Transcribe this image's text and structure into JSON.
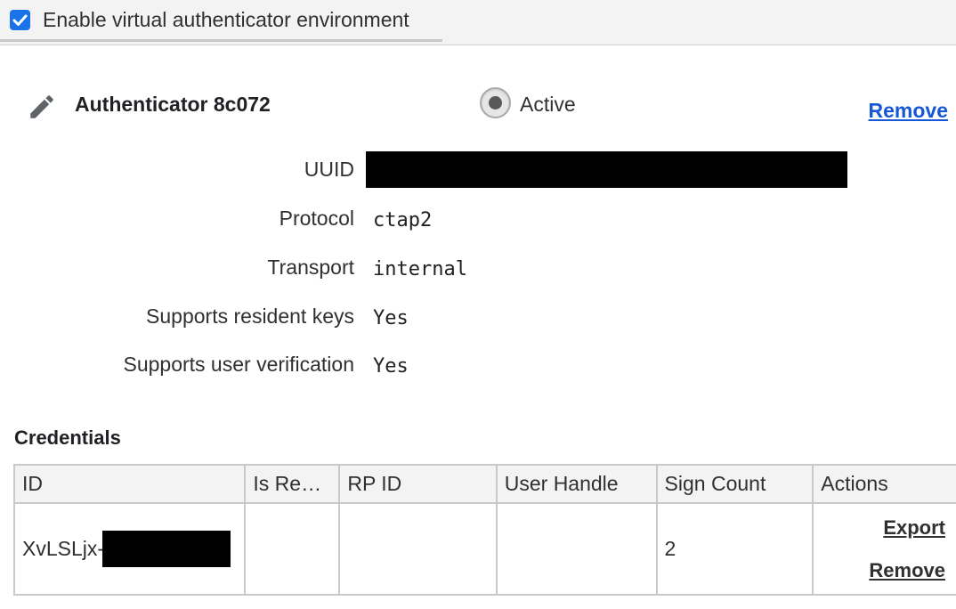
{
  "toolbar": {
    "enable_label": "Enable virtual authenticator environment",
    "enabled": true
  },
  "authenticator": {
    "title": "Authenticator 8c072",
    "active_label": "Active",
    "remove_label": "Remove",
    "properties": [
      {
        "label": "UUID",
        "value": ""
      },
      {
        "label": "Protocol",
        "value": "ctap2"
      },
      {
        "label": "Transport",
        "value": "internal"
      },
      {
        "label": "Supports resident keys",
        "value": "Yes"
      },
      {
        "label": "Supports user verification",
        "value": "Yes"
      }
    ]
  },
  "credentials": {
    "heading": "Credentials",
    "columns": [
      "ID",
      "Is Re…",
      "RP ID",
      "User Handle",
      "Sign Count",
      "Actions"
    ],
    "rows": [
      {
        "id_prefix": "XvLSLjx-",
        "is_resident": "",
        "rp_id": "",
        "user_handle": "",
        "sign_count": "2",
        "export_label": "Export",
        "remove_label": "Remove"
      }
    ]
  },
  "colors": {
    "accent": "#1a73e8",
    "link": "#1558d6"
  }
}
